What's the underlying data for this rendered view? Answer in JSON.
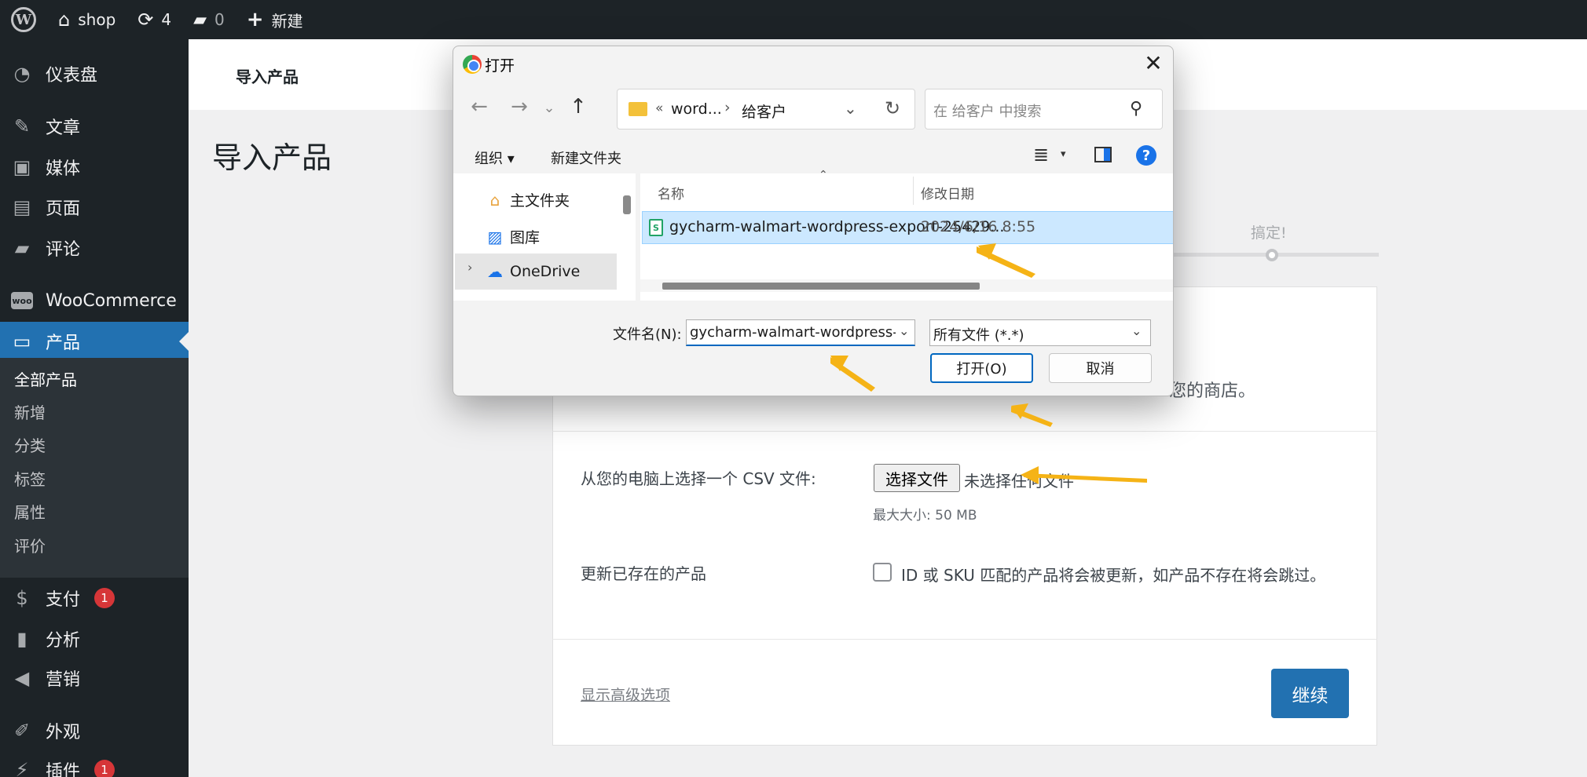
{
  "adminbar": {
    "site_name": "shop",
    "updates_count": "4",
    "comments_count": "0",
    "new_label": "新建"
  },
  "sidebar": {
    "items": [
      {
        "label": "仪表盘",
        "icon": "dashboard-icon"
      },
      {
        "label": "文章",
        "icon": "pin-icon"
      },
      {
        "label": "媒体",
        "icon": "media-icon"
      },
      {
        "label": "页面",
        "icon": "page-icon"
      },
      {
        "label": "评论",
        "icon": "comment-icon"
      },
      {
        "label": "WooCommerce",
        "icon": "woo-icon"
      },
      {
        "label": "产品",
        "icon": "archive-icon"
      },
      {
        "label": "支付",
        "icon": "payment-icon",
        "badge": "1"
      },
      {
        "label": "分析",
        "icon": "chart-icon"
      },
      {
        "label": "营销",
        "icon": "megaphone-icon"
      },
      {
        "label": "外观",
        "icon": "brush-icon"
      },
      {
        "label": "插件",
        "icon": "plugin-icon",
        "badge": "1"
      }
    ],
    "submenu": [
      "全部产品",
      "新增",
      "分类",
      "标签",
      "属性",
      "评价"
    ]
  },
  "header": {
    "title": "导入产品"
  },
  "page": {
    "title": "导入产品",
    "step_label": "搞定!",
    "intro_tail": "您的商店。",
    "csv_label": "从您的电脑上选择一个 CSV 文件:",
    "choose_button": "选择文件",
    "no_file": "未选择任何文件",
    "max_size": "最大大小: 50 MB",
    "update_label": "更新已存在的产品",
    "update_desc": "ID 或 SKU 匹配的产品将会被更新，如产品不存在将会跳过。",
    "advanced_link": "显示高级选项",
    "continue_button": "继续"
  },
  "dialog": {
    "title": "打开",
    "address": {
      "sep": "«",
      "path1": "word...",
      "sep2": "›",
      "path2": "给客户"
    },
    "search_placeholder": "在 给客户 中搜索",
    "organize": "组织 ▾",
    "new_folder": "新建文件夹",
    "nav_items": [
      {
        "label": "主文件夹",
        "icon": "home-icon"
      },
      {
        "label": "图库",
        "icon": "gallery-icon"
      },
      {
        "label": "OneDrive",
        "icon": "cloud-icon"
      }
    ],
    "columns": {
      "name": "名称",
      "date": "修改日期"
    },
    "file": {
      "name": "gycharm-walmart-wordpress-export-25429...",
      "date": "2024/6/16 8:55",
      "icon": "spreadsheet-icon",
      "icon_letter": "S"
    },
    "filename_label": "文件名(N):",
    "filename_value": "gycharm-walmart-wordpress-",
    "filetype_value": "所有文件 (*.*)",
    "open_button": "打开(O)",
    "cancel_button": "取消",
    "help": "?"
  },
  "colors": {
    "wp_dark": "#1d2327",
    "wp_blue": "#2271b1",
    "badge_red": "#d63638",
    "selection": "#cce8ff",
    "arrow": "#f5b316"
  }
}
